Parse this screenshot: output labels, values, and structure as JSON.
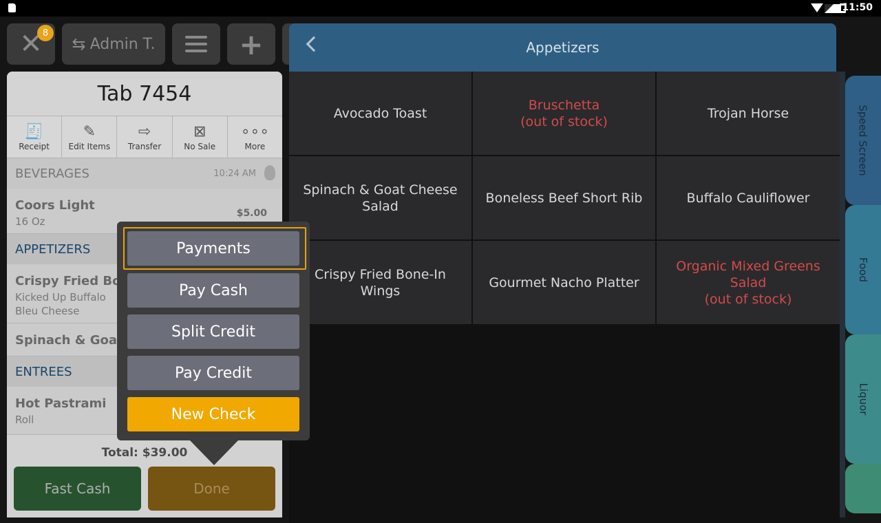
{
  "status_bar": {
    "time": "11:50"
  },
  "top_bar": {
    "badge_count": "8",
    "employee_label": "Admin T."
  },
  "tab": {
    "title": "Tab 7454",
    "actions": [
      {
        "label": "Receipt",
        "icon": "receipt-icon"
      },
      {
        "label": "Edit Items",
        "icon": "edit-icon"
      },
      {
        "label": "Transfer",
        "icon": "arrow-right-icon"
      },
      {
        "label": "No Sale",
        "icon": "x-box-icon"
      },
      {
        "label": "More",
        "icon": "more-dots-icon"
      }
    ],
    "sections": {
      "beverages": {
        "label": "BEVERAGES",
        "time": "10:24 AM"
      },
      "appetizers": {
        "label": "APPETIZERS"
      },
      "entrees": {
        "label": "ENTREES"
      }
    },
    "items": {
      "coors": {
        "name": "Coors Light",
        "mod": "16 Oz",
        "price": "$5.00"
      },
      "wings": {
        "name": "Crispy Fried Bone",
        "mod1": "Kicked Up Buffalo",
        "mod2": "Bleu Cheese"
      },
      "salad": {
        "name": "Spinach & Goat C"
      },
      "pastrami": {
        "name": "Hot Pastrami",
        "mod": "Roll"
      }
    },
    "total": "Total: $39.00",
    "fast_cash": "Fast Cash",
    "done": "Done"
  },
  "popup": {
    "payments": "Payments",
    "pay_cash": "Pay Cash",
    "split_credit": "Split Credit",
    "pay_credit": "Pay Credit",
    "new_check": "New Check"
  },
  "menu": {
    "title": "Appetizers",
    "items": [
      {
        "label": "Avocado Toast",
        "status": ""
      },
      {
        "label": "Bruschetta",
        "status": "(out of stock)"
      },
      {
        "label": "Trojan Horse",
        "status": ""
      },
      {
        "label": "Spinach & Goat Cheese Salad",
        "status": ""
      },
      {
        "label": "Boneless Beef Short Rib",
        "status": ""
      },
      {
        "label": "Buffalo Cauliflower",
        "status": ""
      },
      {
        "label": "Crispy Fried Bone-In Wings",
        "status": ""
      },
      {
        "label": "Gourmet Nacho Platter",
        "status": ""
      },
      {
        "label": "Organic Mixed Greens Salad",
        "status": "(out of stock)"
      }
    ]
  },
  "side_tabs": [
    "Speed Screen",
    "Food",
    "Liquor"
  ],
  "colors": {
    "accent": "#f1a800",
    "header": "#2e5f83",
    "out_of_stock": "#d24b4b"
  }
}
